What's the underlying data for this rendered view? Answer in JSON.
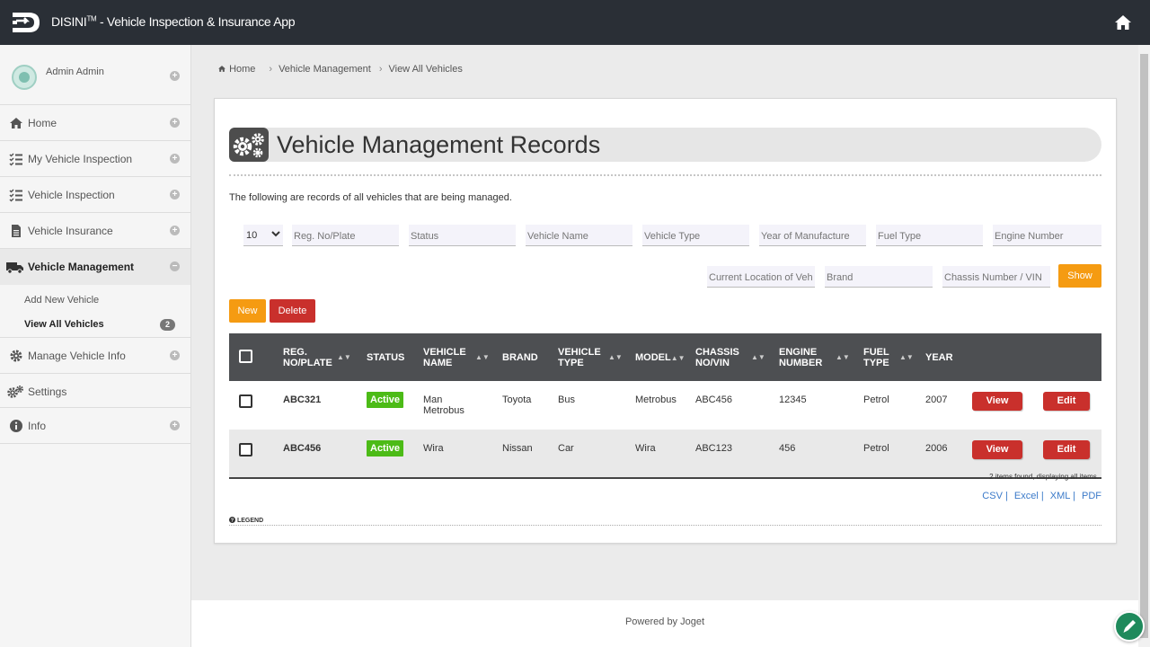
{
  "app": {
    "name": "DISINI",
    "tm": "TM",
    "subtitle": "- Vehicle Inspection & Insurance App",
    "footer": "Powered by Joget"
  },
  "user": {
    "name": "Admin Admin"
  },
  "sidebar": {
    "items": [
      {
        "label": "Home"
      },
      {
        "label": "My Vehicle Inspection"
      },
      {
        "label": "Vehicle Inspection"
      },
      {
        "label": "Vehicle Insurance"
      },
      {
        "label": "Vehicle Management"
      },
      {
        "label": "Manage Vehicle Info"
      },
      {
        "label": "Settings"
      },
      {
        "label": "Info"
      }
    ],
    "subitems": [
      {
        "label": "Add New Vehicle"
      },
      {
        "label": "View All Vehicles",
        "badge": "2"
      }
    ]
  },
  "breadcrumb": {
    "home": "Home",
    "section": "Vehicle Management",
    "page": "View All Vehicles"
  },
  "page": {
    "title": "Vehicle Management Records",
    "description": "The following are records of all vehicles that are being managed."
  },
  "filters": {
    "page_size": "10",
    "reg_no": "Reg. No/Plate",
    "status": "Status",
    "vehicle_name": "Vehicle Name",
    "vehicle_type": "Vehicle Type",
    "year": "Year of Manufacture",
    "fuel_type": "Fuel Type",
    "engine_number": "Engine Number",
    "location": "Current Location of Vehic",
    "brand": "Brand",
    "chassis": "Chassis Number / VIN",
    "show_label": "Show"
  },
  "actions": {
    "new_label": "New",
    "delete_label": "Delete"
  },
  "table": {
    "headers": {
      "reg": "REG. NO/PLATE",
      "status": "STATUS",
      "name": "VEHICLE NAME",
      "brand": "BRAND",
      "type": "VEHICLE TYPE",
      "model": "MODEL",
      "chassis": "CHASSIS NO/VIN",
      "engine": "ENGINE NUMBER",
      "fuel": "FUEL TYPE",
      "year": "YEAR"
    },
    "rows": [
      {
        "reg": "ABC321",
        "status": "Active",
        "name": "Man Metrobus",
        "brand": "Toyota",
        "type": "Bus",
        "model": "Metrobus",
        "chassis": "ABC456",
        "engine": "12345",
        "fuel": "Petrol",
        "year": "2007",
        "view": "View",
        "edit": "Edit"
      },
      {
        "reg": "ABC456",
        "status": "Active",
        "name": "Wira",
        "brand": "Nissan",
        "type": "Car",
        "model": "Wira",
        "chassis": "ABC123",
        "engine": "456",
        "fuel": "Petrol",
        "year": "2006",
        "view": "View",
        "edit": "Edit"
      }
    ],
    "summary": "2 items found, displaying all items."
  },
  "exports": [
    "CSV",
    "Excel",
    "XML",
    "PDF"
  ],
  "legend": "LEGEND",
  "colors": {
    "topbar": "#2a2f36",
    "accent_orange": "#f59b12",
    "danger": "#c9302c",
    "active": "#4cbb17",
    "table_header": "#4d4f52"
  }
}
